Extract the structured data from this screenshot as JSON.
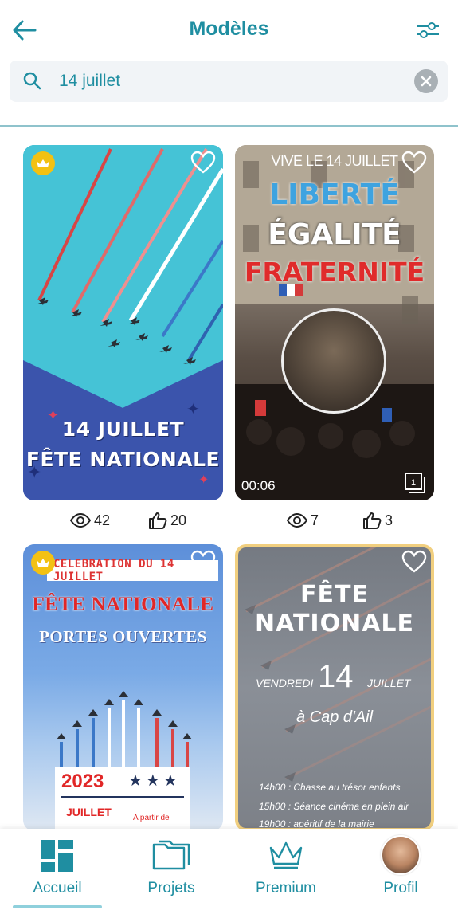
{
  "header": {
    "title": "Modèles"
  },
  "search": {
    "value": "14 juillet",
    "placeholder": ""
  },
  "templates": [
    {
      "lines": [
        "14 JUILLET",
        "FÊTE NATIONALE"
      ],
      "premium": true,
      "views": "42",
      "likes": "20"
    },
    {
      "top_text": "VIVE LE 14 JUILLET",
      "lines": [
        "LIBERTÉ",
        "ÉGALITÉ",
        "FRATERNITÉ"
      ],
      "duration": "00:06",
      "page_count": "1",
      "views": "7",
      "likes": "3"
    },
    {
      "ribbon": "CELEBRATION DU 14 JUILLET",
      "lines": [
        "FÊTE NATIONALE",
        "PORTES OUVERTES"
      ],
      "year": "2023",
      "stars": "★★★",
      "month": "JUILLET",
      "note": "A partir de",
      "premium": true
    },
    {
      "lines": [
        "FÊTE",
        "NATIONALE"
      ],
      "day": "VENDREDI",
      "number": "14",
      "month": "JUILLET",
      "place": "à Cap d'Ail",
      "program": [
        "14h00 : Chasse au trésor enfants",
        "15h00 : Séance cinéma en plein air",
        "19h00 : apéritif de la mairie"
      ]
    }
  ],
  "nav": [
    {
      "label": "Accueil",
      "active": true
    },
    {
      "label": "Projets"
    },
    {
      "label": "Premium"
    },
    {
      "label": "Profil"
    }
  ],
  "colors": {
    "accent": "#1f8ea1",
    "premium": "#f3c112"
  }
}
